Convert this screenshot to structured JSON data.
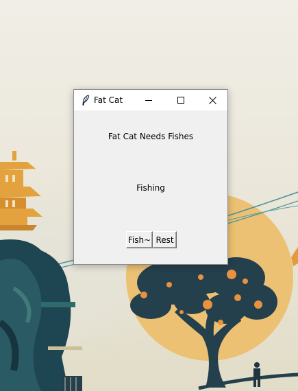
{
  "window": {
    "title": "Fat Cat",
    "icon": "feather-icon",
    "controls": {
      "minimize": "minimize-icon",
      "maximize": "maximize-icon",
      "close": "close-icon"
    }
  },
  "content": {
    "heading": "Fat Cat Needs Fishes",
    "status": "Fishing",
    "buttons": {
      "fish_label": "Fish~",
      "rest_label": "Rest"
    }
  },
  "colors": {
    "window_bg": "#f0f0f0",
    "titlebar_bg": "#ffffff",
    "sun": "#ecc173",
    "tree": "#24404d"
  }
}
